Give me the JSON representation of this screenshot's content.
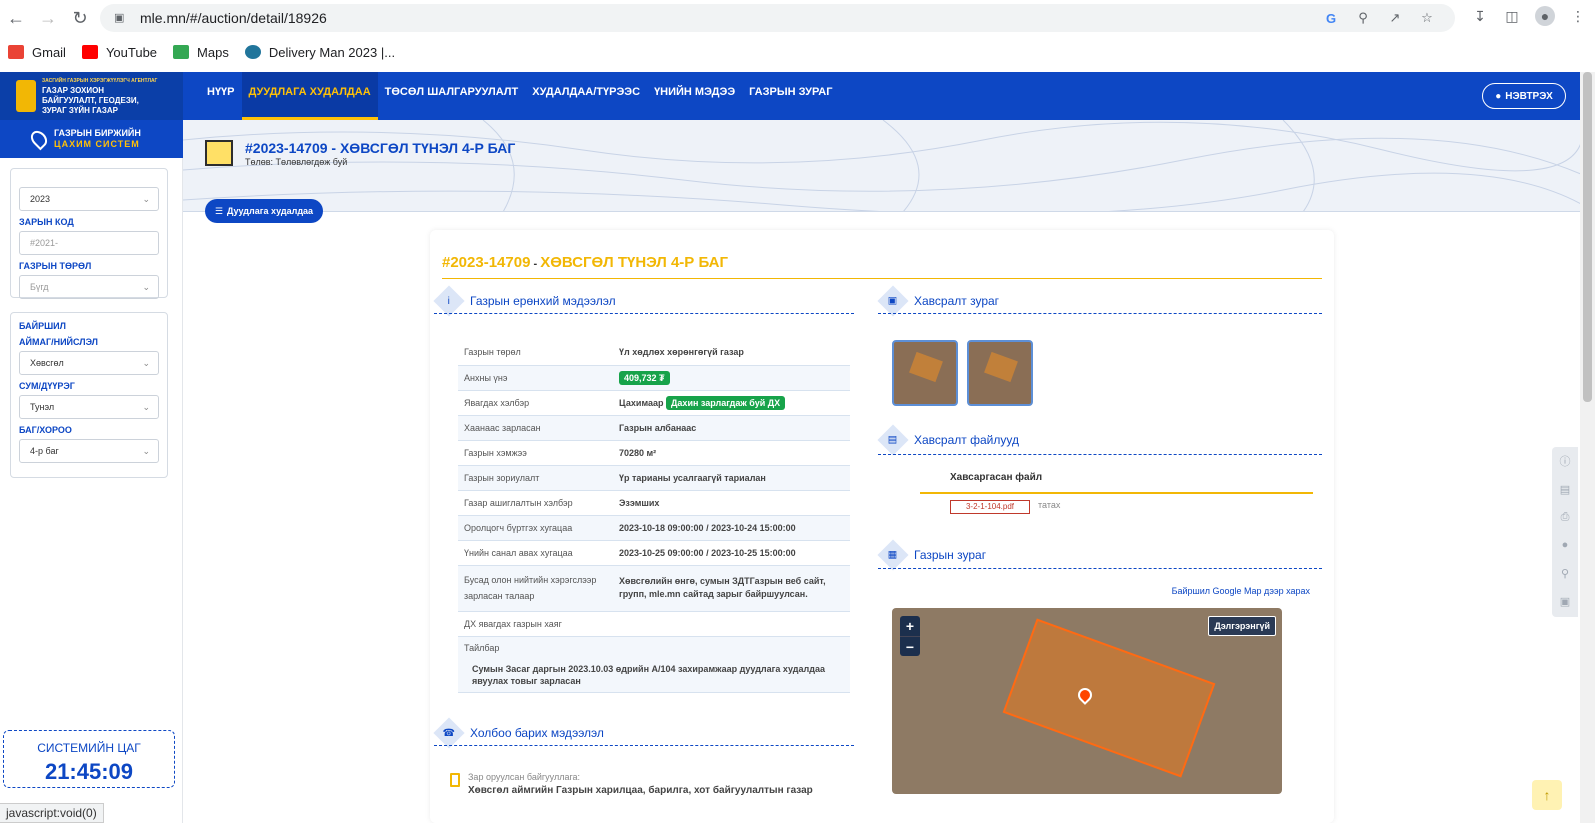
{
  "browser": {
    "url": "mle.mn/#/auction/detail/18926",
    "bookmarks": [
      {
        "label": "Gmail",
        "color": "#ea4335"
      },
      {
        "label": "YouTube",
        "color": "#ff0000"
      },
      {
        "label": "Maps",
        "color": "#34a853"
      },
      {
        "label": "Delivery Man 2023 |...",
        "color": "#21759b"
      }
    ],
    "status": "javascript:void(0)"
  },
  "header": {
    "logo_small": "ЗАСГИЙН ГАЗРЫН ХЭРЭГЖҮҮЛЭГЧ АГЕНТЛАГ",
    "logo_main": "ГАЗАР ЗОХИОН БАЙГУУЛАЛТ, ГЕОДЕЗИ, ЗУРАГ ЗҮЙН ГАЗАР",
    "nav": [
      "НҮҮР",
      "ДУУДЛАГА ХУДАЛДАА",
      "ТӨСӨЛ ШАЛГАРУУЛАЛТ",
      "ХУДАЛДАА/ТҮРЭЭС",
      "ҮНИЙН МЭДЭЭ",
      "ГАЗРЫН ЗУРАГ"
    ],
    "active_nav": 1,
    "login": "НЭВТРЭХ"
  },
  "sidebar": {
    "badge_line1": "ГАЗРЫН БИРЖИЙН",
    "badge_line2": "ЦАХИМ СИСТЕМ",
    "year_value": "2023",
    "code_label": "ЗАРЫН КОД",
    "code_placeholder": "#2021-",
    "type_label": "ГАЗРЫН ТӨРӨЛ",
    "type_value": "Бүгд",
    "location_label": "БАЙРШИЛ",
    "aimag_label": "АЙМАГ/НИЙСЛЭЛ",
    "aimag_value": "Хөвсгөл",
    "sum_label": "СУМ/ДҮҮРЭГ",
    "sum_value": "Тунэл",
    "bag_label": "БАГ/ХОРОО",
    "bag_value": "4-р баг",
    "clock_title": "СИСТЕМИЙН ЦАГ",
    "clock_time": "21:45:09"
  },
  "banner": {
    "title": "#2023-14709 - ХӨВСГӨЛ ТҮНЭЛ 4-Р БАГ",
    "status": "Төлөв: Төлөвлөгдөж буй",
    "back_button": "Дуудлага худалдаа"
  },
  "detail": {
    "code": "#2023-14709",
    "dash": " - ",
    "name": "ХӨВСГӨЛ ТҮНЭЛ 4-Р БАГ",
    "general_title": "Газрын ерөнхий мэдээлэл",
    "rows": [
      {
        "k": "Газрын төрөл",
        "v": "Үл хөдлөх хөрөнгөгүй газар"
      },
      {
        "k": "Анхны үнэ",
        "v": "409,732 ₮"
      },
      {
        "k": "Явагдах хэлбэр",
        "v": "Цахимаар",
        "badge": "Дахин зарлагдаж буй ДХ"
      },
      {
        "k": "Хаанаас зарласан",
        "v": "Газрын албанаас"
      },
      {
        "k": "Газрын хэмжээ",
        "v": "70280 м²"
      },
      {
        "k": "Газрын зориулалт",
        "v": "Үр тарианы усалгаагүй тариалан"
      },
      {
        "k": "Газар ашиглалтын хэлбэр",
        "v": "Эзэмших"
      },
      {
        "k": "Оролцогч бүртгэх хугацаа",
        "v": "2023-10-18 09:00:00 / 2023-10-24 15:00:00"
      },
      {
        "k": "Үнийн санал авах хугацаа",
        "v": "2023-10-25 09:00:00 / 2023-10-25 15:00:00"
      },
      {
        "k": "Бусад олон нийтийн хэрэгслээр зарласан талаар",
        "v": "Хөвсгөлийн өнгө, сумын ЗДТГазрын веб сайт, групп, mle.mn сайтад зарыг байршуулсан."
      },
      {
        "k": "ДХ явагдах газрын хаяг",
        "v": ""
      },
      {
        "k": "Тайлбар",
        "v": ""
      }
    ],
    "note": "Сумын Засаг даргын 2023.10.03 өдрийн А/104 захирамжаар дуудлага худалдаа явуулах товыг зарласан",
    "attached_images_title": "Хавсралт зураг",
    "attached_files_title": "Хавсралт файлууд",
    "files_header": "Хавсаргасан файл",
    "file_name": "3-2-1-104.pdf",
    "download": "татах",
    "map_title": "Газрын зураг",
    "map_link": "Байршил Google Map дээр харах",
    "map_more": "Дэлгэрэнгүй",
    "contact_title": "Холбоо барих мэдээлэл",
    "contact_label": "Зар оруулсан байгууллага:",
    "contact_value": "Хөвсгөл аймгийн Газрын харилцаа, барилга, хот байгуулалтын газар"
  }
}
